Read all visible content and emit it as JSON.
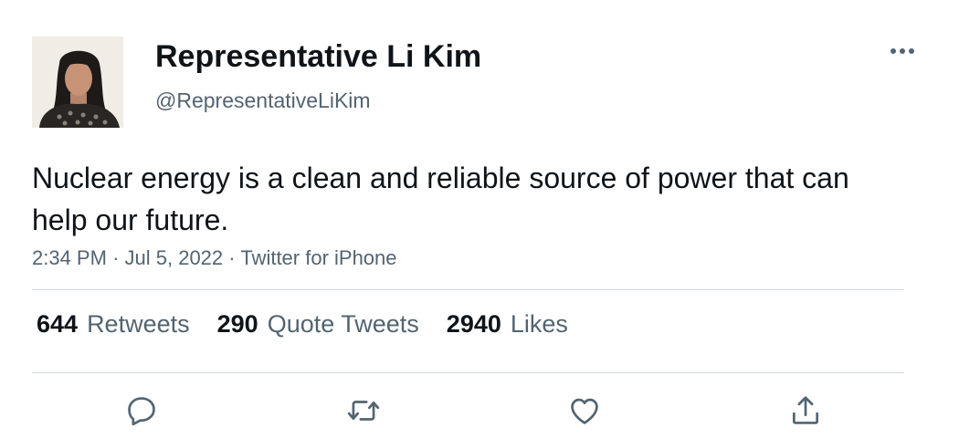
{
  "user": {
    "display_name": "Representative Li Kim",
    "handle": "@RepresentativeLiKim"
  },
  "tweet": {
    "text": "Nuclear energy is a clean and reliable source of power that can help our future.",
    "time": "2:34 PM",
    "date": "Jul 5, 2022",
    "source": "Twitter for iPhone",
    "separator": "·"
  },
  "stats": [
    {
      "count": "644",
      "label": "Retweets"
    },
    {
      "count": "290",
      "label": "Quote Tweets"
    },
    {
      "count": "2940",
      "label": "Likes"
    }
  ],
  "icons": {
    "more": "more-horizontal-icon",
    "reply": "reply-icon",
    "retweet": "retweet-icon",
    "like": "heart-icon",
    "share": "share-icon"
  },
  "colors": {
    "text_primary": "#0f1419",
    "text_secondary": "#536471",
    "divider": "#cfd9de"
  }
}
